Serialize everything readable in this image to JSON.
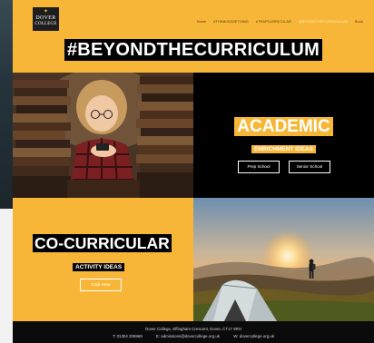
{
  "logo": {
    "line1": "DOVER",
    "line2": "COLLEGE"
  },
  "nav": {
    "items": [
      {
        "label": "Home",
        "active": false
      },
      {
        "label": "#THINKSOMETHING",
        "active": false
      },
      {
        "label": "#TRAPCURRICULAR",
        "active": false
      },
      {
        "label": "#BEYONDTHECURRICULUM",
        "active": true
      },
      {
        "label": "Book",
        "active": false
      }
    ]
  },
  "hero": {
    "hashtag": "#BEYONDTHECURRICULUM"
  },
  "academic": {
    "title": "ACADEMIC",
    "subtitle": "ENRICHMENT IDEAS",
    "buttons": {
      "prep": "Prep School",
      "senior": "Senior School"
    }
  },
  "cocurricular": {
    "title": "CO-CURRICULAR",
    "subtitle": "ACTIVITY IDEAS",
    "button": "Click Here"
  },
  "footer": {
    "address": "Dover College, Effingham Crescent, Dover, CT17 9RH",
    "phone": "T: 01304 205969",
    "email": "E: admissions@dovercollege.org.uk",
    "web": "W: dovercollege.org.uk"
  },
  "colors": {
    "brand": "#f7b637",
    "dark": "#000000"
  }
}
